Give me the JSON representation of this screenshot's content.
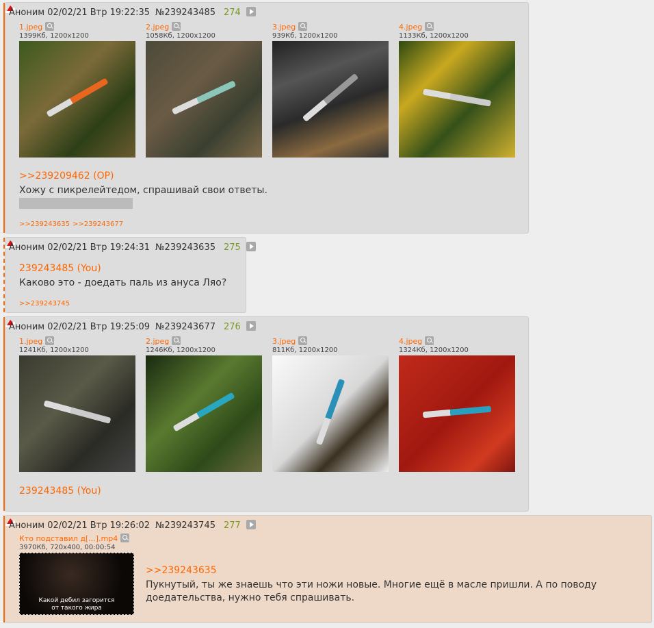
{
  "accent": "#ff6600",
  "posts": [
    {
      "name": "Аноним",
      "date": "02/02/21 Втр 19:22:35",
      "number": "№239243485",
      "count": "274",
      "files": [
        {
          "name": "1.jpeg",
          "info": "1399Кб, 1200x1200"
        },
        {
          "name": "2.jpeg",
          "info": "1058Кб, 1200x1200"
        },
        {
          "name": "3.jpeg",
          "info": "939Кб, 1200x1200"
        },
        {
          "name": "4.jpeg",
          "info": "1133Кб, 1200x1200"
        }
      ],
      "quote": ">>239209462 (OP)",
      "text": [
        "Хожу с пикрелейтедом, спрашивай свои ответы."
      ],
      "replies": [
        ">>239243635",
        ">>239243677"
      ]
    },
    {
      "name": "Аноним",
      "date": "02/02/21 Втр 19:24:31",
      "number": "№239243635",
      "count": "275",
      "files": [],
      "quote": "239243485 (You)",
      "text": [
        "Каково это - доедать паль из ануса Ляо?"
      ],
      "replies": [
        ">>239243745"
      ]
    },
    {
      "name": "Аноним",
      "date": "02/02/21 Втр 19:25:09",
      "number": "№239243677",
      "count": "276",
      "files": [
        {
          "name": "1.jpeg",
          "info": "1241Кб, 1200x1200"
        },
        {
          "name": "2.jpeg",
          "info": "1246Кб, 1200x1200"
        },
        {
          "name": "3.jpeg",
          "info": "811Кб, 1200x1200"
        },
        {
          "name": "4.jpeg",
          "info": "1324Кб, 1200x1200"
        }
      ],
      "quote": "239243485 (You)",
      "text": [],
      "replies": []
    },
    {
      "name": "Аноним",
      "date": "02/02/21 Втр 19:26:02",
      "number": "№239243745",
      "count": "277",
      "files": [
        {
          "name": "Кто подставил д[...].mp4",
          "info": "3970Кб, 720x400, 00:00:54",
          "caption": [
            "Какой дебил загорится",
            "от такого жира"
          ]
        }
      ],
      "quote": ">>239243635",
      "text": [
        "Пукнутый, ты же знаешь что эти ножи новые. Многие ещё в масле пришли. А по поводу",
        "доедательства, нужно тебя спрашивать."
      ],
      "replies": []
    }
  ]
}
